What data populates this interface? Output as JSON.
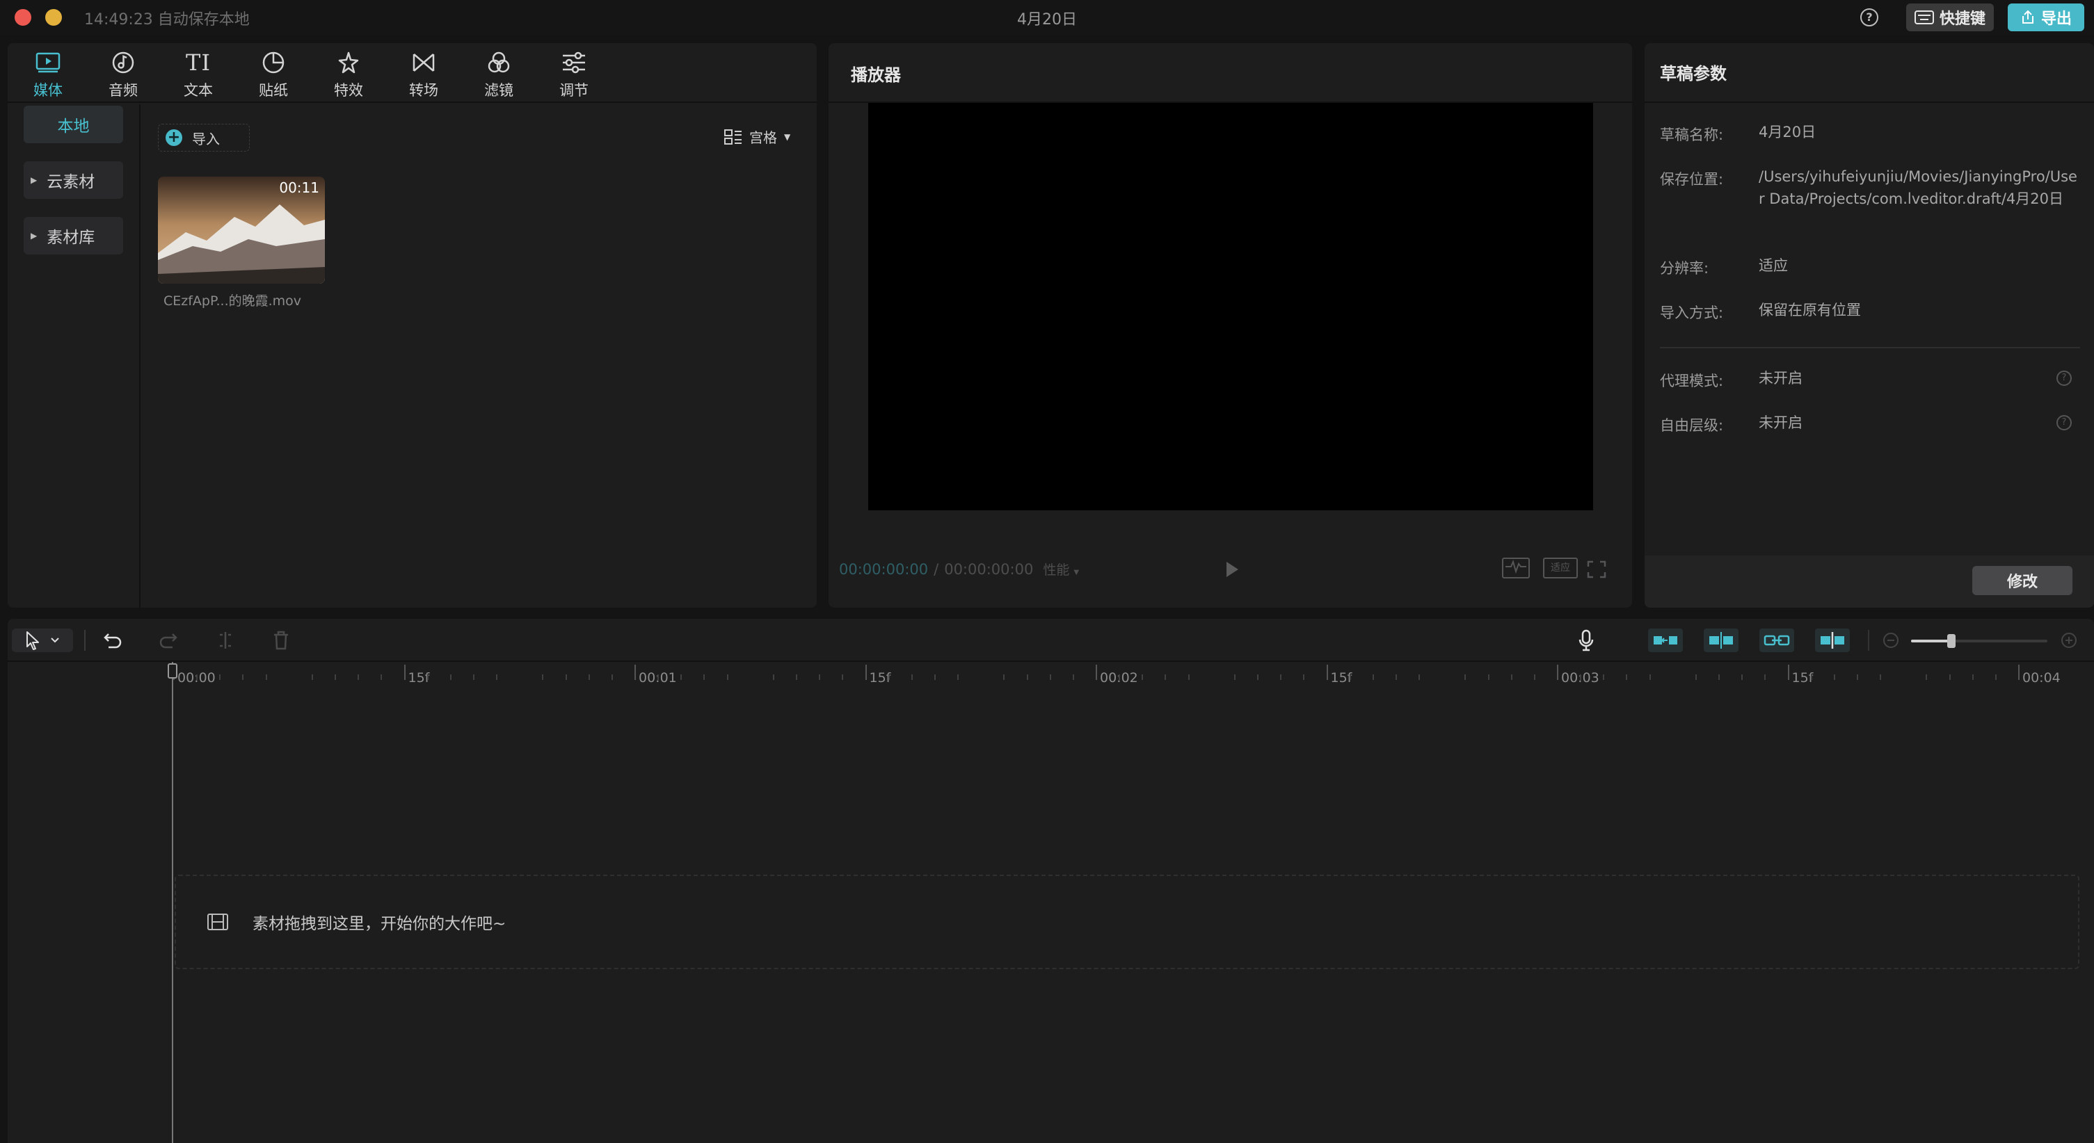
{
  "titlebar": {
    "save_status": "14:49:23 自动保存本地",
    "project_title": "4月20日",
    "help_icon": "help-circle-icon",
    "shortcut_label": "快捷键",
    "export_label": "导出"
  },
  "media_panel": {
    "tabs": [
      {
        "label": "媒体",
        "icon": "media-play-icon",
        "active": true
      },
      {
        "label": "音频",
        "icon": "audio-note-icon",
        "active": false
      },
      {
        "label": "文本",
        "icon": "text-ti-icon",
        "active": false
      },
      {
        "label": "贴纸",
        "icon": "sticker-icon",
        "active": false
      },
      {
        "label": "特效",
        "icon": "effects-star-icon",
        "active": false
      },
      {
        "label": "转场",
        "icon": "transition-bowtie-icon",
        "active": false
      },
      {
        "label": "滤镜",
        "icon": "filter-circles-icon",
        "active": false
      },
      {
        "label": "调节",
        "icon": "adjust-sliders-icon",
        "active": false
      }
    ],
    "sidebar": [
      {
        "label": "本地",
        "active": true
      },
      {
        "label": "云素材",
        "active": false
      },
      {
        "label": "素材库",
        "active": false
      }
    ],
    "import_label": "导入",
    "view_label": "宫格",
    "clips": [
      {
        "name": "CEzfApP...的晚霞.mov",
        "duration": "00:11"
      }
    ]
  },
  "player": {
    "title": "播放器",
    "current_time": "00:00:00:00",
    "separator": "/",
    "total_time": "00:00:00:00",
    "quality_label": "性能",
    "ratio_label": "适应"
  },
  "draft_params": {
    "title": "草稿参数",
    "rows": [
      {
        "label": "草稿名称:",
        "value": "4月20日"
      },
      {
        "label": "保存位置:",
        "value": "/Users/yihufeiyunjiu/Movies/JianyingPro/User Data/Projects/com.lveditor.draft/4月20日"
      },
      {
        "label": "分辨率:",
        "value": "适应"
      },
      {
        "label": "导入方式:",
        "value": "保留在原有位置"
      },
      {
        "label": "代理模式:",
        "value": "未开启"
      },
      {
        "label": "自由层级:",
        "value": "未开启"
      }
    ],
    "modify_label": "修改"
  },
  "timeline": {
    "ruler_labels": [
      "00:00",
      "15f",
      "00:01",
      "15f",
      "00:02",
      "15f",
      "00:03",
      "15f",
      "00:04"
    ],
    "drop_hint": "素材拖拽到这里，开始你的大作吧~"
  },
  "colors": {
    "accent": "#48c0d0",
    "background": "#141414",
    "panel": "#1d1d1e"
  }
}
